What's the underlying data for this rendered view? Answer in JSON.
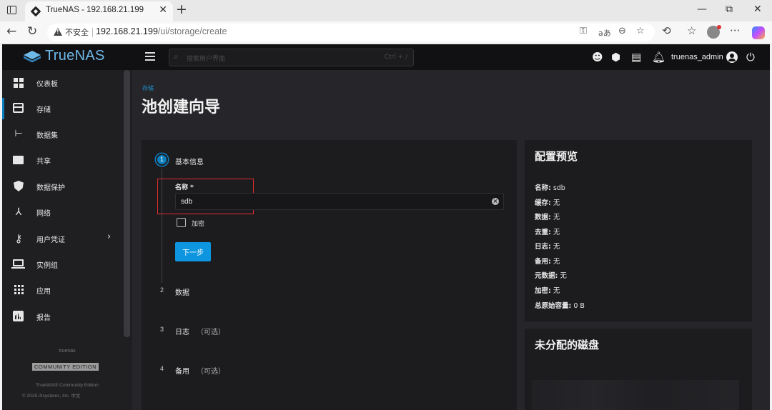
{
  "browser": {
    "tab_title": "TrueNAS - 192.168.21.199",
    "tab_close": "✕",
    "new_tab": "+",
    "security_label": "不安全",
    "url_host": "192.168.21.199",
    "url_path": "/ui/storage/create",
    "window_controls": [
      "—",
      "⧉",
      "✕"
    ]
  },
  "app": {
    "brand": "TrueNAS",
    "search_placeholder": "搜索用户界面",
    "search_shortcut": "Ctrl + /",
    "username": "truenas_admin"
  },
  "sidebar": {
    "items": [
      {
        "label": "仪表板",
        "icon": "dashboard-icon"
      },
      {
        "label": "存储",
        "icon": "storage-icon",
        "active": true
      },
      {
        "label": "数据集",
        "icon": "datasets-icon"
      },
      {
        "label": "共享",
        "icon": "shares-icon"
      },
      {
        "label": "数据保护",
        "icon": "shield-icon"
      },
      {
        "label": "网络",
        "icon": "network-icon"
      },
      {
        "label": "用户凭证",
        "icon": "key-icon",
        "has_submenu": true
      },
      {
        "label": "实例组",
        "icon": "laptop-icon"
      },
      {
        "label": "应用",
        "icon": "apps-icon"
      },
      {
        "label": "报告",
        "icon": "report-icon"
      }
    ],
    "footer_hostname": "truenas",
    "footer_edition_badge": "COMMUNITY EDITION",
    "footer_version": "TrueNAS® Community Edition",
    "footer_copyright": "© 2025 iXsystems, Inc. 中文"
  },
  "page": {
    "breadcrumb": "存储",
    "title": "池创建向导"
  },
  "wizard": {
    "steps": [
      {
        "num": "1",
        "label": "基本信息",
        "optional": ""
      },
      {
        "num": "2",
        "label": "数据",
        "optional": ""
      },
      {
        "num": "3",
        "label": "日志",
        "optional": "（可选）"
      },
      {
        "num": "4",
        "label": "备用",
        "optional": "（可选）"
      }
    ],
    "name_label": "名称 *",
    "name_value": "sdb",
    "encrypt_label": "加密",
    "encrypt_checked": false,
    "next_button": "下一步"
  },
  "preview": {
    "title": "配置预览",
    "rows": [
      {
        "key": "名称:",
        "value": " sdb"
      },
      {
        "key": "缓存:",
        "value": " 无"
      },
      {
        "key": "数据:",
        "value": " 无"
      },
      {
        "key": "去重:",
        "value": " 无"
      },
      {
        "key": "日志:",
        "value": " 无"
      },
      {
        "key": "备用:",
        "value": " 无"
      },
      {
        "key": "元数据:",
        "value": " 无"
      },
      {
        "key": "加密:",
        "value": " 无"
      },
      {
        "key": "总原始容量:",
        "value": " 0 B"
      }
    ]
  },
  "unassigned": {
    "title": "未分配的磁盘"
  },
  "colors": {
    "accent": "#0d95e0",
    "brand": "#6fb9e7",
    "highlight": "#e02b2b"
  }
}
